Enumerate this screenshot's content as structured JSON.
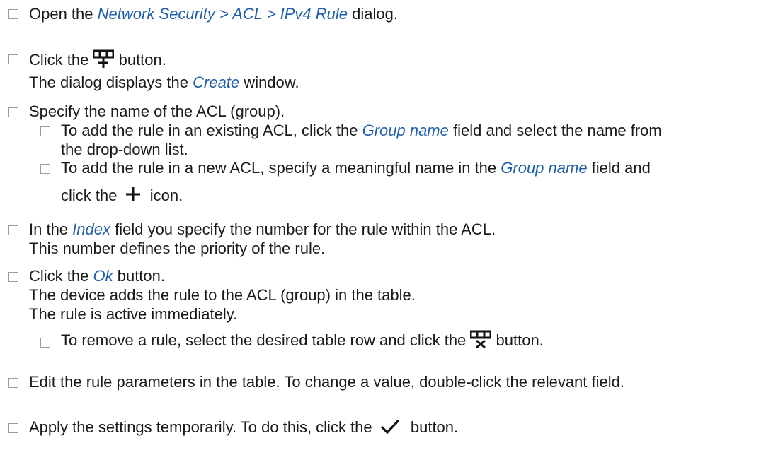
{
  "steps": [
    {
      "a": "Open the ",
      "ref": "Network Security > ACL > IPv4 Rule",
      "b": " dialog."
    },
    {
      "a": "Click the ",
      "b": " button.",
      "result": {
        "a": "The dialog displays the ",
        "ref": "Create",
        "b": " window."
      }
    },
    {
      "a": "Specify the name of the ACL (group)."
    },
    {
      "a": "To add the rule in an existing ACL, click the ",
      "ref": "Group name",
      "b": " field and select the name from",
      "line2": "the drop-down list."
    },
    {
      "a": "To add the rule in a new ACL, specify a meaningful name in the ",
      "ref": "Group name",
      "b": " field and",
      "line2a": "click the ",
      "line2b": " icon."
    },
    {
      "a": "In the ",
      "ref": "Index",
      "b": " field you specify the number for the rule within the ACL.",
      "line2": "This number defines the priority of the rule."
    },
    {
      "a": "Click the ",
      "ref": "Ok",
      "b": " button.",
      "line2": "The device adds the rule to the ACL (group) in the table.",
      "line3": "The rule is active immediately."
    },
    {
      "a": "To remove a rule, select the desired table row and click the ",
      "b": " button."
    },
    {
      "a": "Edit the rule parameters in the table. To change a value, double-click the relevant field."
    },
    {
      "a": "Apply the settings temporarily. To do this, click the ",
      "b": " button."
    }
  ],
  "icons": {
    "create": "create-table-row-icon",
    "add": "plus-icon",
    "remove": "remove-table-row-icon",
    "apply": "checkmark-icon"
  }
}
